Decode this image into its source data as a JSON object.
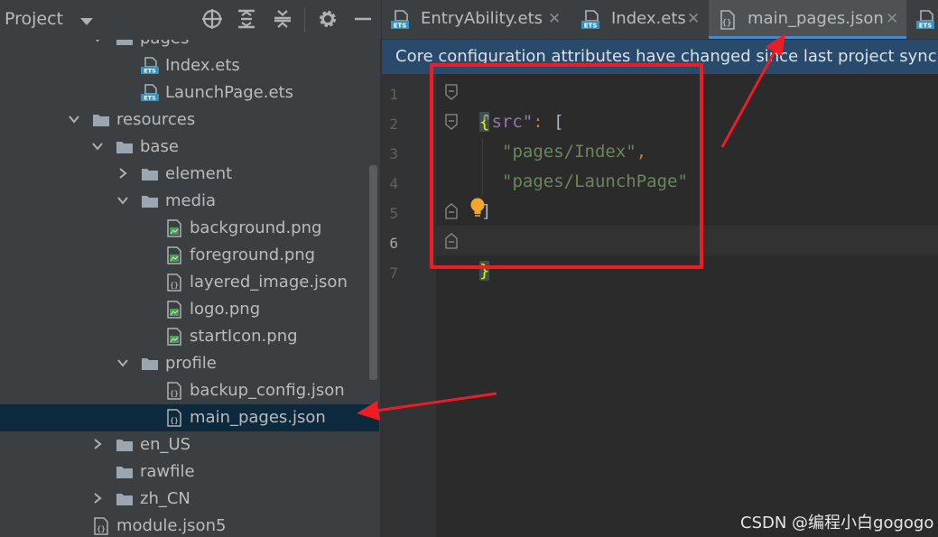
{
  "project_panel": {
    "title": "Project",
    "header_icons": [
      "dropdown-caret-icon",
      "locate-target-icon",
      "expand-all-icon",
      "collapse-all-icon",
      "gear-icon",
      "hide-minus-icon"
    ],
    "tree": [
      {
        "label": "pages",
        "icon": "folder-icon",
        "expanded": true
      },
      {
        "label": "Index.ets",
        "icon": "ets-file-icon"
      },
      {
        "label": "LaunchPage.ets",
        "icon": "ets-file-icon"
      },
      {
        "label": "resources",
        "icon": "folder-icon",
        "expanded": true
      },
      {
        "label": "base",
        "icon": "folder-icon",
        "expanded": true
      },
      {
        "label": "element",
        "icon": "folder-icon",
        "expanded": false
      },
      {
        "label": "media",
        "icon": "folder-icon",
        "expanded": true
      },
      {
        "label": "background.png",
        "icon": "image-file-icon"
      },
      {
        "label": "foreground.png",
        "icon": "image-file-icon"
      },
      {
        "label": "layered_image.json",
        "icon": "json-file-icon"
      },
      {
        "label": "logo.png",
        "icon": "image-file-icon"
      },
      {
        "label": "startIcon.png",
        "icon": "image-file-icon"
      },
      {
        "label": "profile",
        "icon": "folder-icon",
        "expanded": true
      },
      {
        "label": "backup_config.json",
        "icon": "json-file-icon"
      },
      {
        "label": "main_pages.json",
        "icon": "json-file-icon",
        "selected": true
      },
      {
        "label": "en_US",
        "icon": "folder-icon",
        "expanded": false
      },
      {
        "label": "rawfile",
        "icon": "folder-icon"
      },
      {
        "label": "zh_CN",
        "icon": "folder-icon",
        "expanded": false
      },
      {
        "label": "module.json5",
        "icon": "json-file-icon"
      }
    ]
  },
  "tabs": [
    {
      "label": "EntryAbility.ets",
      "icon": "ets-file-icon",
      "close": "✕"
    },
    {
      "label": "Index.ets",
      "icon": "ets-file-icon",
      "close": "✕"
    },
    {
      "label": "main_pages.json",
      "icon": "json-file-icon",
      "close": "✕",
      "active": true
    },
    {
      "label": "",
      "icon": "ets-file-icon"
    }
  ],
  "banner": {
    "text": "Core configuration attributes have changed since last project sync. A p"
  },
  "editor": {
    "line_numbers": [
      "1",
      "2",
      "3",
      "4",
      "5",
      "6",
      "7"
    ],
    "code": {
      "l1_brace": "{",
      "l2_key": "\"src\"",
      "l2_colon": ":",
      "l2_bracket": "[",
      "l3_str": "\"pages/Index\"",
      "l3_comma": ",",
      "l4_str": "\"pages/LaunchPage\"",
      "l5_bracket": "]",
      "l6_brace": "}"
    },
    "current_line": "6"
  },
  "watermark": {
    "text": "CSDN @编程小白gogogo"
  },
  "colors": {
    "panel_bg": "#3c3f41",
    "editor_bg": "#2b2b2b",
    "selection": "#0d293e",
    "banner": "#294a6b",
    "annotation_red": "#ee1c25",
    "string": "#6a8759",
    "key": "#9876aa"
  }
}
